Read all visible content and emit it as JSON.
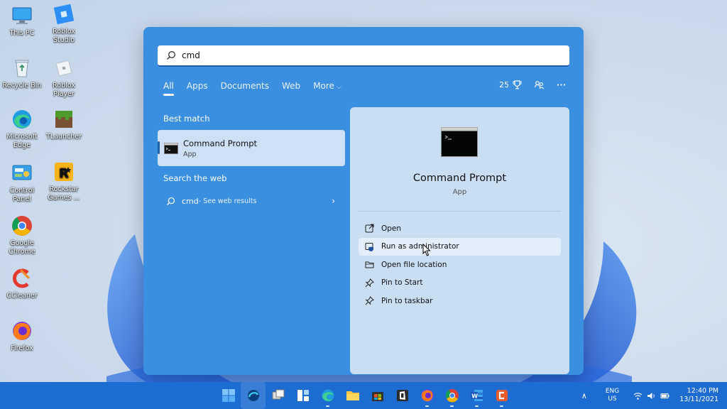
{
  "desktop": {
    "icons": [
      {
        "label": "This PC"
      },
      {
        "label": "Roblox Studio"
      },
      {
        "label": "Recycle Bin"
      },
      {
        "label": "Roblox Player"
      },
      {
        "label": "Microsoft Edge"
      },
      {
        "label": "TLauncher"
      },
      {
        "label": "Control Panel"
      },
      {
        "label": "Rockstar Games ..."
      },
      {
        "label": "Google Chrome"
      },
      {
        "label": "CCleaner"
      },
      {
        "label": "Firefox"
      }
    ]
  },
  "search": {
    "query": "cmd",
    "tabs": [
      {
        "label": "All",
        "active": true
      },
      {
        "label": "Apps"
      },
      {
        "label": "Documents"
      },
      {
        "label": "Web"
      },
      {
        "label": "More"
      }
    ],
    "points": "25",
    "sections": {
      "best_match": "Best match",
      "search_web": "Search the web"
    },
    "best_match": {
      "title": "Command Prompt",
      "subtitle": "App"
    },
    "web_result": {
      "query": "cmd",
      "suffix": " - See web results"
    }
  },
  "detail": {
    "title": "Command Prompt",
    "subtitle": "App",
    "actions": [
      {
        "label": "Open",
        "icon": "open-external-icon"
      },
      {
        "label": "Run as administrator",
        "icon": "shield-window-icon",
        "hovered": true
      },
      {
        "label": "Open file location",
        "icon": "folder-icon"
      },
      {
        "label": "Pin to Start",
        "icon": "pin-icon"
      },
      {
        "label": "Pin to taskbar",
        "icon": "pin-icon"
      }
    ]
  },
  "taskbar": {
    "lang_top": "ENG",
    "lang_bottom": "US",
    "time": "12:40 PM",
    "date": "13/11/2021"
  },
  "colors": {
    "panel": "#3a8fe0",
    "detail_pane": "#c9ddf3",
    "taskbar": "#1d6cd1"
  }
}
